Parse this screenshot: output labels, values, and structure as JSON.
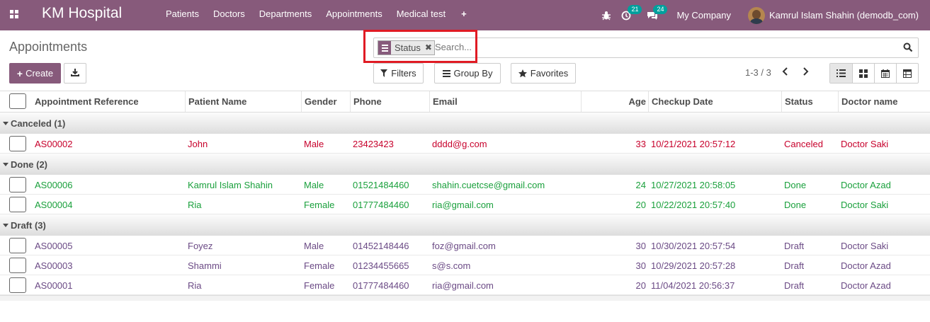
{
  "navbar": {
    "brand": "KM Hospital",
    "menu": [
      "Patients",
      "Doctors",
      "Departments",
      "Appointments",
      "Medical test"
    ],
    "plus": "+",
    "activity_badge": "21",
    "message_badge": "24",
    "company": "My Company",
    "user": "Kamrul Islam Shahin (demodb_com)"
  },
  "control": {
    "title": "Appointments",
    "facet_label": "Status",
    "search_placeholder": "Search...",
    "create_label": "Create",
    "filters_label": "Filters",
    "groupby_label": "Group By",
    "favorites_label": "Favorites",
    "pager": "1-3 / 3"
  },
  "table": {
    "headers": [
      "Appointment Reference",
      "Patient Name",
      "Gender",
      "Phone",
      "Email",
      "Age",
      "Checkup Date",
      "Status",
      "Doctor name"
    ],
    "groups": [
      {
        "label": "Canceled (1)",
        "status": "canceled",
        "rows": [
          {
            "ref": "AS00002",
            "patient": "John",
            "gender": "Male",
            "phone": "23423423",
            "email": "dddd@g.com",
            "age": "33",
            "date": "10/21/2021 20:57:12",
            "status": "Canceled",
            "doctor": "Doctor Saki"
          }
        ]
      },
      {
        "label": "Done (2)",
        "status": "done",
        "rows": [
          {
            "ref": "AS00006",
            "patient": "Kamrul Islam Shahin",
            "gender": "Male",
            "phone": "01521484460",
            "email": "shahin.cuetcse@gmail.com",
            "age": "24",
            "date": "10/27/2021 20:58:05",
            "status": "Done",
            "doctor": "Doctor Azad"
          },
          {
            "ref": "AS00004",
            "patient": "Ria",
            "gender": "Female",
            "phone": "01777484460",
            "email": "ria@gmail.com",
            "age": "20",
            "date": "10/22/2021 20:57:40",
            "status": "Done",
            "doctor": "Doctor Saki"
          }
        ]
      },
      {
        "label": "Draft (3)",
        "status": "draft",
        "rows": [
          {
            "ref": "AS00005",
            "patient": "Foyez",
            "gender": "Male",
            "phone": "01452148446",
            "email": "foz@gmail.com",
            "age": "30",
            "date": "10/30/2021 20:57:54",
            "status": "Draft",
            "doctor": "Doctor Saki"
          },
          {
            "ref": "AS00003",
            "patient": "Shammi",
            "gender": "Female",
            "phone": "01234455665",
            "email": "s@s.com",
            "age": "30",
            "date": "10/29/2021 20:57:28",
            "status": "Draft",
            "doctor": "Doctor Azad"
          },
          {
            "ref": "AS00001",
            "patient": "Ria",
            "gender": "Female",
            "phone": "01777484460",
            "email": "ria@gmail.com",
            "age": "20",
            "date": "11/04/2021 20:56:37",
            "status": "Draft",
            "doctor": "Doctor Azad"
          }
        ]
      }
    ]
  },
  "colors": {
    "brand": "#875a7b",
    "canceled": "#c7002b",
    "done": "#1aa03c",
    "draft": "#875a7b",
    "highlight": "#e01b24",
    "badge": "#00a09d"
  }
}
